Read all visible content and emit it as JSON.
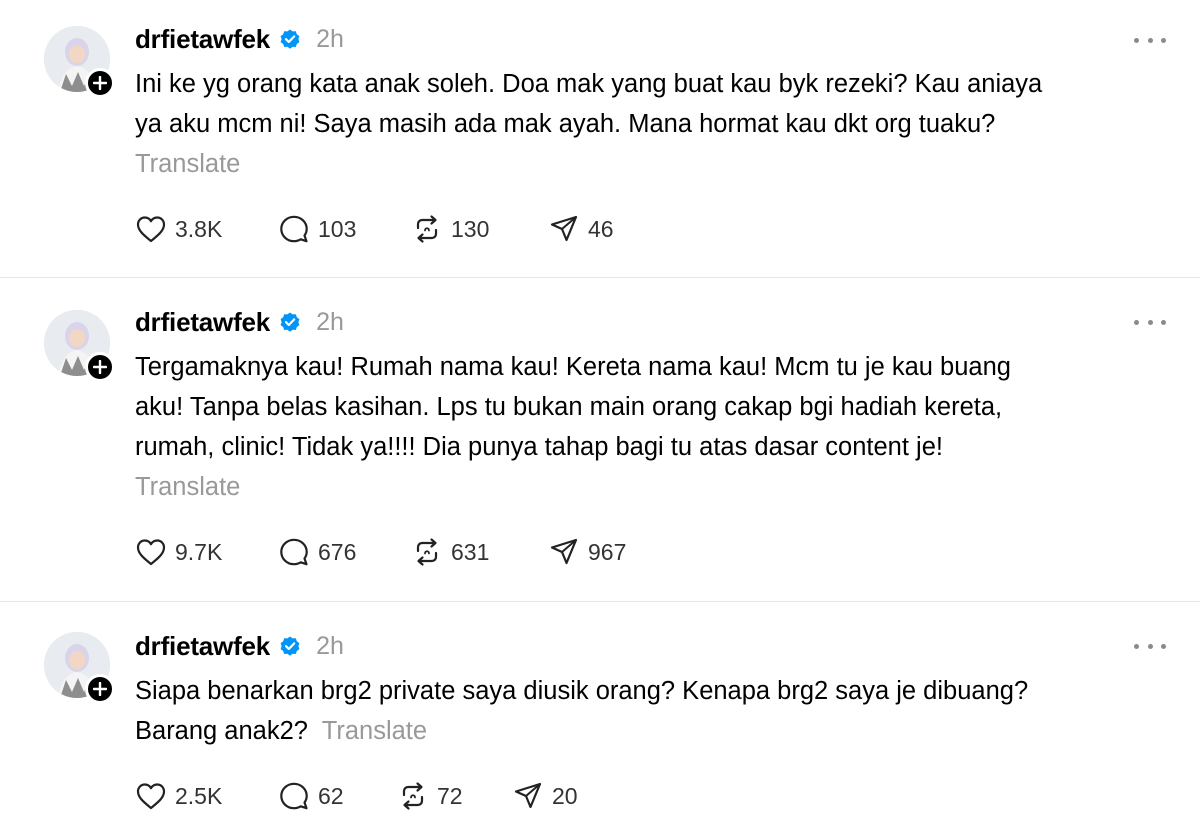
{
  "posts": [
    {
      "username": "drfietawfek",
      "time": "2h",
      "text_lines": [
        "Ini ke yg orang kata anak soleh. Doa mak yang buat kau byk rezeki? Kau aniaya",
        "ya aku mcm ni! Saya masih ada mak ayah. Mana hormat kau dkt org tuaku?"
      ],
      "translate": "Translate",
      "likes": "3.8K",
      "replies": "103",
      "reposts": "130",
      "shares": "46"
    },
    {
      "username": "drfietawfek",
      "time": "2h",
      "text_lines": [
        "Tergamaknya kau! Rumah nama kau! Kereta nama kau! Mcm tu je kau buang",
        "aku! Tanpa belas kasihan. Lps tu bukan main orang cakap bgi hadiah kereta,",
        "rumah, clinic! Tidak ya!!!! Dia punya tahap bagi tu atas dasar content je!"
      ],
      "translate": "Translate",
      "likes": "9.7K",
      "replies": "676",
      "reposts": "631",
      "shares": "967"
    },
    {
      "username": "drfietawfek",
      "time": "2h",
      "text_lines": [
        "Siapa benarkan brg2 private saya diusik orang? Kenapa brg2 saya je dibuang?",
        "Barang anak2?"
      ],
      "translate": "Translate",
      "likes": "2.5K",
      "replies": "62",
      "reposts": "72",
      "shares": "20"
    }
  ],
  "icons": {
    "like": "heart-icon",
    "reply": "comment-bubble-icon",
    "repost": "repost-arrows-icon",
    "share": "send-paper-plane-icon",
    "verified": "verified-badge-icon",
    "more": "more-dots-icon",
    "follow": "plus-icon"
  },
  "colors": {
    "verified": "#0095f6",
    "muted": "#999999",
    "divider": "#e5e5e5"
  }
}
